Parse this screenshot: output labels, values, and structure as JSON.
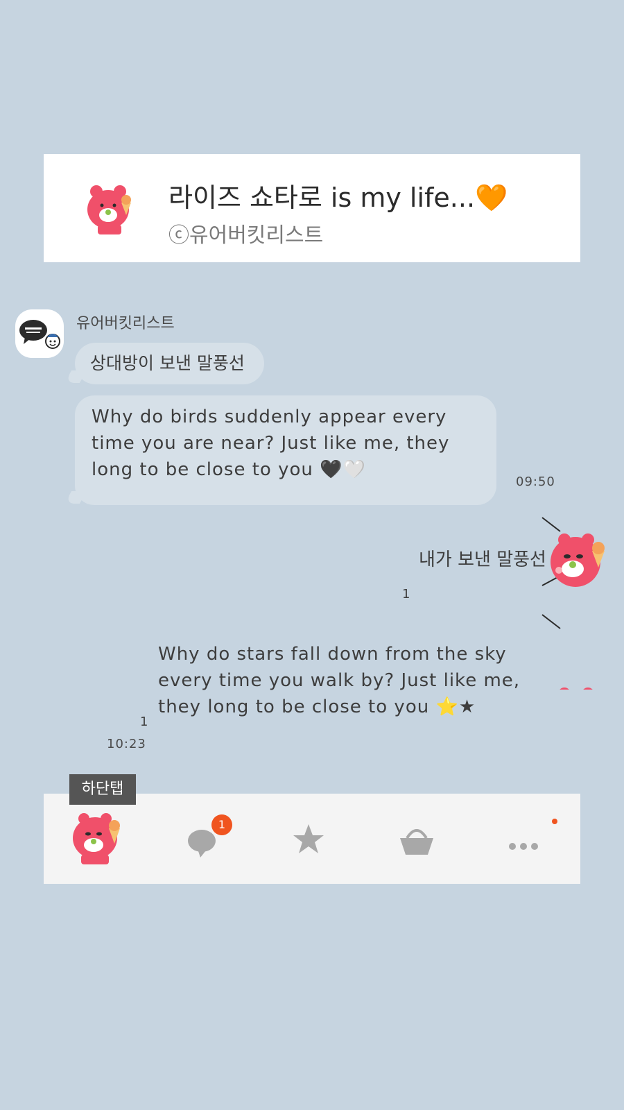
{
  "banner": {
    "title": "라이즈 쇼타로 is my life...🧡",
    "subtitle": "ⓒ유어버킷리스트"
  },
  "friend": {
    "name": "유어버킷리스트"
  },
  "messages_in": [
    {
      "text": "상대방이 보낸 말풍선"
    },
    {
      "text": "Why do birds suddenly appear every time you are near? Just like me, they long to be close to you 🖤🤍",
      "time": "09:50"
    }
  ],
  "messages_out": [
    {
      "text": "내가 보낸 말풍선",
      "unread": "1"
    },
    {
      "text": "Why do stars fall down from the sky every time you walk by? Just like me, they long to be close to you ⭐★",
      "unread": "1",
      "time": "10:23"
    }
  ],
  "tabbar": {
    "label": "하단탭",
    "chat_badge": "1",
    "tabs": [
      {
        "icon": "mascot-profile-icon"
      },
      {
        "icon": "chat-bubble-icon"
      },
      {
        "icon": "star-icon"
      },
      {
        "icon": "shopping-basket-icon"
      },
      {
        "icon": "more-dots-icon"
      }
    ],
    "icon_color": "#a8a8a8",
    "badge_color": "#f0541f"
  },
  "colors": {
    "background": "#c6d4e0",
    "bubble_in": "#d6e0e8",
    "mascot": "#f0506a"
  }
}
